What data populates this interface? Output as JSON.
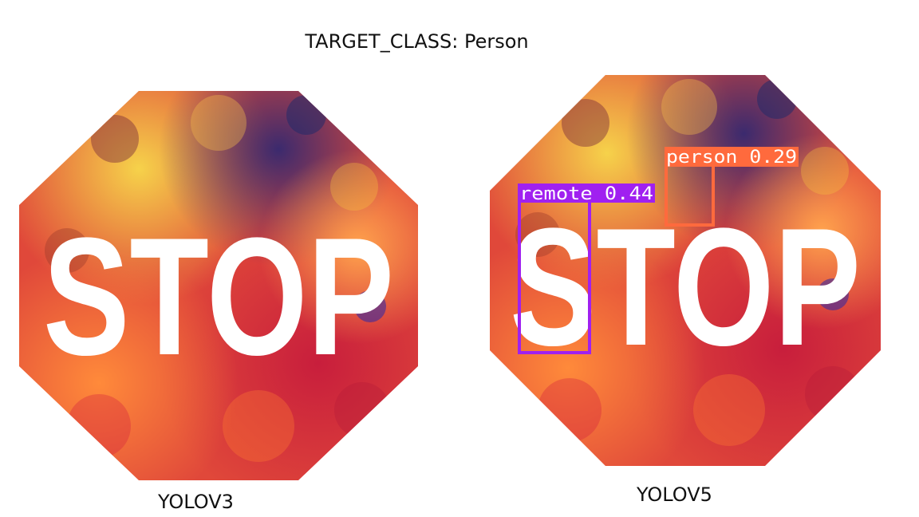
{
  "title": "TARGET_CLASS: Person",
  "colors": {
    "octagon_base": "#e0483a",
    "stop_text": "#ffffff",
    "remote_box": "#a020f0",
    "person_box": "#ff6a3d",
    "label_text": "#ffffff"
  },
  "panels": [
    {
      "caption": "YOLOV3",
      "sign_text": "STOP",
      "detections": []
    },
    {
      "caption": "YOLOV5",
      "sign_text": "STOP",
      "detections": [
        {
          "label": "remote 0.44",
          "class": "remote",
          "score": 0.44
        },
        {
          "label": "person 0.29",
          "class": "person",
          "score": 0.29
        }
      ]
    }
  ]
}
